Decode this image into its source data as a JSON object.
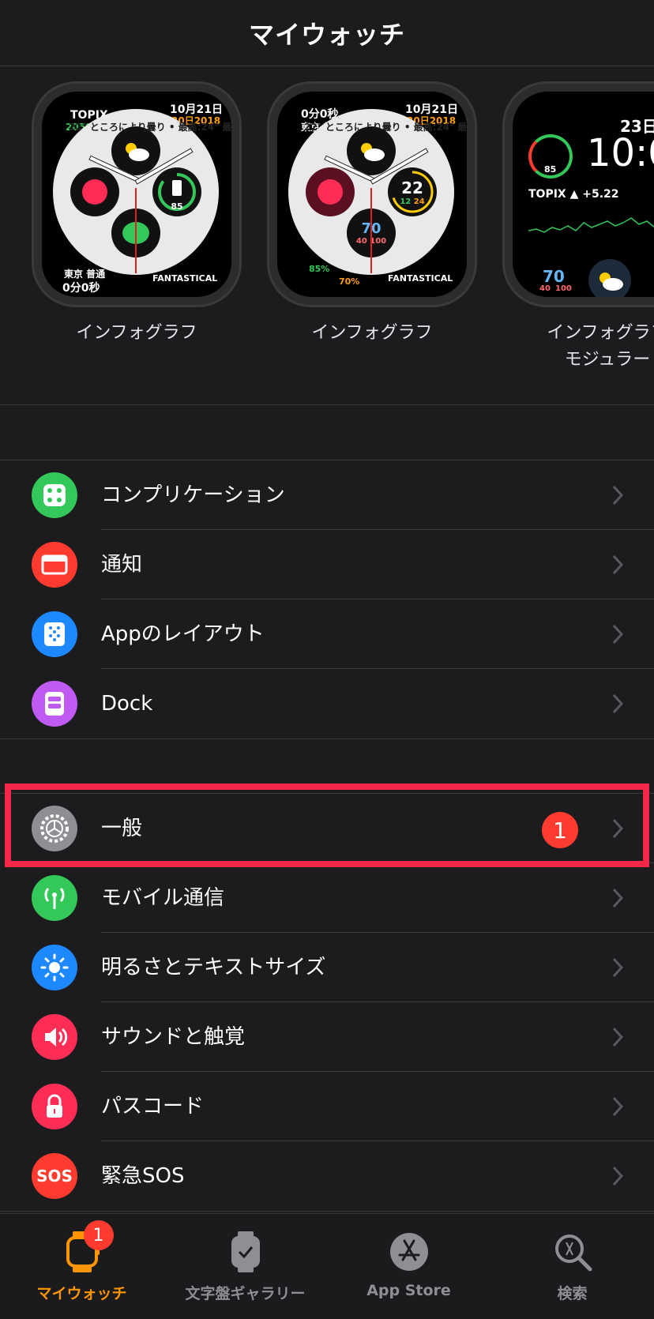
{
  "nav": {
    "title": "マイウォッチ"
  },
  "faces": [
    {
      "label": "インフォグラフ",
      "texts": {
        "tl1": "TOPIX",
        "tl2": "2050.33 +5.22",
        "tr1": "平成30日2018",
        "tr2": "10月21日",
        "arc": "22° ところにより曇り • 最高:24° 最低:",
        "bl1": "東京 普通",
        "bl2": "0分0秒",
        "br": "FANTASTICAL",
        "battery": "85"
      }
    },
    {
      "label": "インフォグラフ",
      "texts": {
        "tl1": "0分0秒",
        "tl2": "東京 普通",
        "tr1": "平成30日2018",
        "tr2": "10月21日",
        "arc": "22° ところにより曇り • 最高:24° 最低:",
        "temp": "22",
        "temp_lo": "12",
        "temp_hi": "24",
        "aqi": "70",
        "aqi_lo": "40",
        "aqi_hi": "100",
        "bl": "85%",
        "bl2": "70%",
        "br": "FANTASTICAL"
      }
    },
    {
      "label": "インフォグラフ\nモジュラー",
      "texts": {
        "date": "23日",
        "time": "10:0",
        "topix": "TOPIX ▲ +5.22",
        "aqi": "70",
        "aqi_lo": "40",
        "aqi_hi": "100",
        "battery": "85"
      }
    }
  ],
  "group1": [
    {
      "label": "コンプリケーション",
      "icon": "complications-icon",
      "color": "#34c759"
    },
    {
      "label": "通知",
      "icon": "notifications-icon",
      "color": "#ff3b30"
    },
    {
      "label": "Appのレイアウト",
      "icon": "app-layout-icon",
      "color": "#1e88ff"
    },
    {
      "label": "Dock",
      "icon": "dock-icon",
      "color": "#bf5af2"
    }
  ],
  "group2": [
    {
      "label": "一般",
      "icon": "gear-icon",
      "color": "#8e8e93",
      "badge": "1"
    },
    {
      "label": "モバイル通信",
      "icon": "cellular-icon",
      "color": "#34c759"
    },
    {
      "label": "明るさとテキストサイズ",
      "icon": "brightness-icon",
      "color": "#1e88ff"
    },
    {
      "label": "サウンドと触覚",
      "icon": "sound-icon",
      "color": "#ff2d55"
    },
    {
      "label": "パスコード",
      "icon": "lock-icon",
      "color": "#ff2d55"
    },
    {
      "label": "緊急SOS",
      "icon": "sos-icon",
      "color": "#ff3b30",
      "icon_text": "SOS"
    }
  ],
  "tabs": [
    {
      "label": "マイウォッチ",
      "icon": "watch-icon",
      "active": true,
      "badge": "1"
    },
    {
      "label": "文字盤ギャラリー",
      "icon": "face-gallery-icon"
    },
    {
      "label": "App Store",
      "icon": "app-store-icon"
    },
    {
      "label": "検索",
      "icon": "search-icon"
    }
  ]
}
